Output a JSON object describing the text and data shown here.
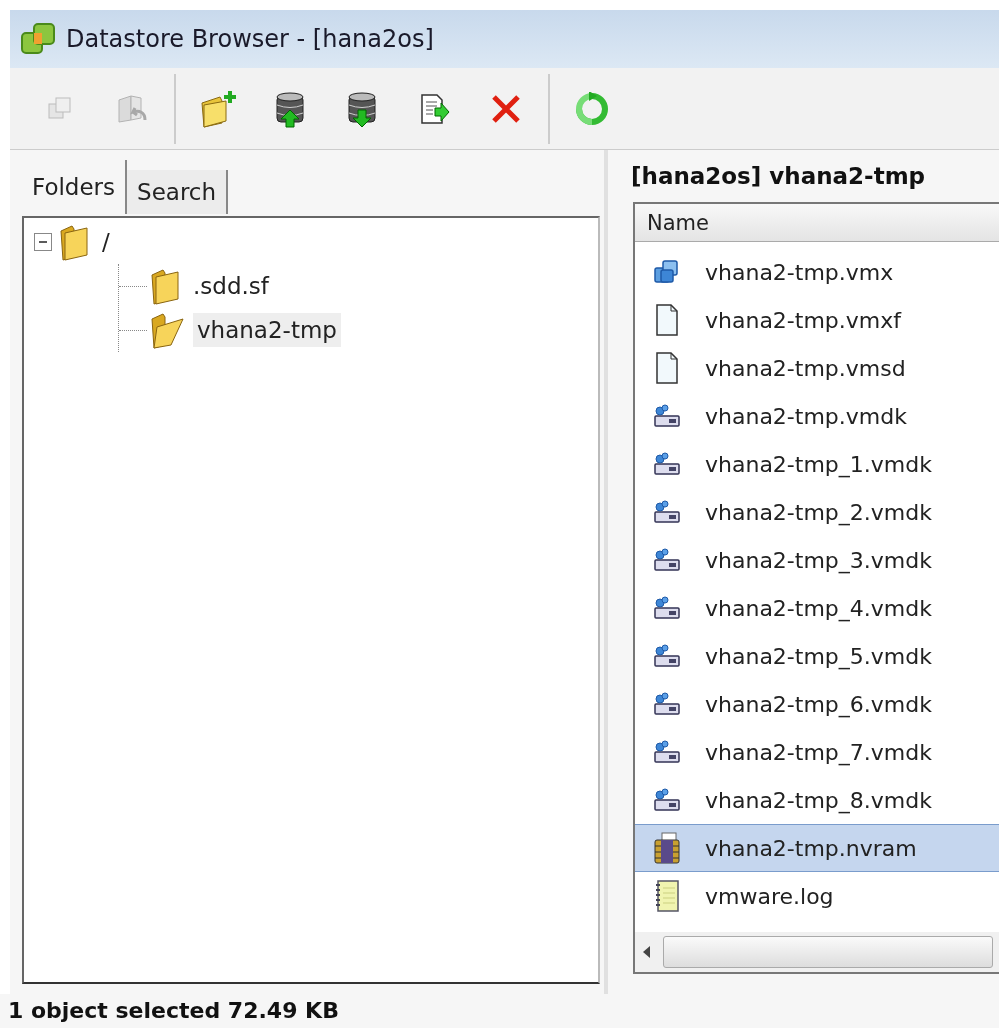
{
  "window": {
    "title": "Datastore Browser - [hana2os]"
  },
  "toolbar": [
    {
      "kind": "copy",
      "disabled": true
    },
    {
      "kind": "move",
      "disabled": true
    },
    {
      "kind": "new-folder",
      "disabled": false
    },
    {
      "kind": "upload",
      "disabled": false
    },
    {
      "kind": "download",
      "disabled": false
    },
    {
      "kind": "register",
      "disabled": false
    },
    {
      "kind": "delete",
      "disabled": false
    },
    {
      "kind": "refresh",
      "disabled": false
    }
  ],
  "tabs": [
    {
      "label": "Folders",
      "selected": true
    },
    {
      "label": "Search",
      "selected": false
    }
  ],
  "tree": [
    {
      "label": "/",
      "expanded": true,
      "selected": false,
      "children": [
        {
          "label": ".sdd.sf",
          "expanded": false,
          "selected": false
        },
        {
          "label": "vhana2-tmp",
          "expanded": true,
          "selected": true
        }
      ]
    }
  ],
  "path": "[hana2os] vhana2-tmp",
  "table": {
    "columns": [
      "Name"
    ],
    "rows": [
      {
        "kind": "vm",
        "name": "vhana2-tmp.vmx",
        "selected": false
      },
      {
        "kind": "file",
        "name": "vhana2-tmp.vmxf",
        "selected": false
      },
      {
        "kind": "file",
        "name": "vhana2-tmp.vmsd",
        "selected": false
      },
      {
        "kind": "disk",
        "name": "vhana2-tmp.vmdk",
        "selected": false
      },
      {
        "kind": "disk",
        "name": "vhana2-tmp_1.vmdk",
        "selected": false
      },
      {
        "kind": "disk",
        "name": "vhana2-tmp_2.vmdk",
        "selected": false
      },
      {
        "kind": "disk",
        "name": "vhana2-tmp_3.vmdk",
        "selected": false
      },
      {
        "kind": "disk",
        "name": "vhana2-tmp_4.vmdk",
        "selected": false
      },
      {
        "kind": "disk",
        "name": "vhana2-tmp_5.vmdk",
        "selected": false
      },
      {
        "kind": "disk",
        "name": "vhana2-tmp_6.vmdk",
        "selected": false
      },
      {
        "kind": "disk",
        "name": "vhana2-tmp_7.vmdk",
        "selected": false
      },
      {
        "kind": "disk",
        "name": "vhana2-tmp_8.vmdk",
        "selected": false
      },
      {
        "kind": "nvram",
        "name": "vhana2-tmp.nvram",
        "selected": true
      },
      {
        "kind": "log",
        "name": "vmware.log",
        "selected": false
      }
    ]
  },
  "status_bar": "1 object selected 72.49 KB"
}
